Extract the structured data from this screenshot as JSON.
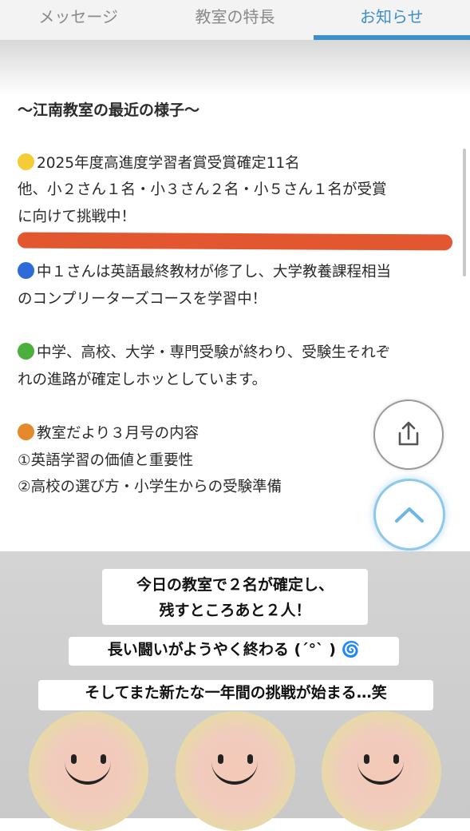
{
  "tabs": [
    {
      "label": "メッセージ",
      "active": false
    },
    {
      "label": "教室の特長",
      "active": false
    },
    {
      "label": "お知らせ",
      "active": true
    }
  ],
  "colors": {
    "accent": "#3d8fc7",
    "redaction": "#e2572f"
  },
  "article": {
    "heading": "〜江南教室の最近の様子〜",
    "item1_line1": "2025年度高進度学習者賞受賞確定11名",
    "item1_line2": "他、小２さん１名・小３さん２名・小５さん１名が受賞",
    "item1_line3": "に向けて挑戦中！",
    "item2_line1": "中１さんは英語最終教材が修了し、大学教養課程相当",
    "item2_line2": "のコンプリーターズコースを学習中！",
    "item3_line1": "中学、高校、大学・専門受験が終わり、受験生それぞ",
    "item3_line2": "れの進路が確定しホッとしています。",
    "item4_line1": "教室だより３月号の内容",
    "item4_line2": "①英語学習の価値と重要性",
    "item4_line3": "②高校の選び方・小学生からの受験準備"
  },
  "icons": {
    "share": "share-icon",
    "up": "chevron-up-icon"
  },
  "overlay": {
    "caption1_line1": "今日の教室で２名が確定し、",
    "caption1_line2": "残すところあと２人！",
    "caption2": "長い闘いがようやく終わる (´°` ) 🌀",
    "caption3": "そしてまた新たな一年間の挑戦が始まる…笑"
  }
}
